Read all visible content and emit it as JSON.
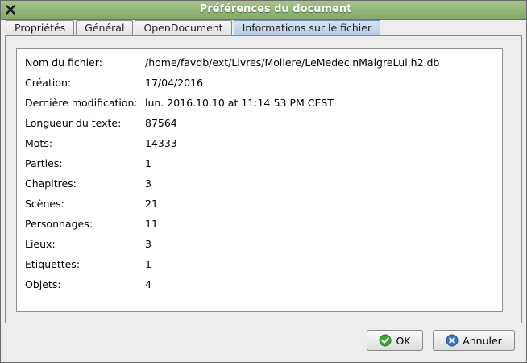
{
  "window": {
    "title": "Préférences du document"
  },
  "tabs": [
    {
      "label": "Propriétés",
      "active": false
    },
    {
      "label": "Général",
      "active": false
    },
    {
      "label": "OpenDocument",
      "active": false
    },
    {
      "label": "Informations sur le fichier",
      "active": true
    }
  ],
  "info": [
    {
      "label": "Nom du fichier:",
      "value": "/home/favdb/ext/Livres/Moliere/LeMedecinMalgreLui.h2.db"
    },
    {
      "label": "Création:",
      "value": "17/04/2016"
    },
    {
      "label": "Dernière modification:",
      "value": "lun. 2016.10.10 at 11:14:53 PM CEST"
    },
    {
      "label": "Longueur du texte:",
      "value": "87564"
    },
    {
      "label": "Mots:",
      "value": "14333"
    },
    {
      "label": "Parties:",
      "value": "1"
    },
    {
      "label": "Chapitres:",
      "value": "3"
    },
    {
      "label": "Scènes:",
      "value": "21"
    },
    {
      "label": "Personnages:",
      "value": "11"
    },
    {
      "label": "Lieux:",
      "value": "3"
    },
    {
      "label": "Etiquettes:",
      "value": "1"
    },
    {
      "label": "Objets:",
      "value": "4"
    }
  ],
  "buttons": {
    "ok_label": "OK",
    "cancel_label": "Annuler"
  },
  "icons": {
    "close": "close-icon",
    "ok": "check-circle-icon",
    "cancel": "x-circle-icon"
  },
  "colors": {
    "titlebar": "#95b779",
    "active_tab": "#c4d5ec",
    "ok_icon": "#3aa63a",
    "cancel_icon": "#3f73c4"
  }
}
